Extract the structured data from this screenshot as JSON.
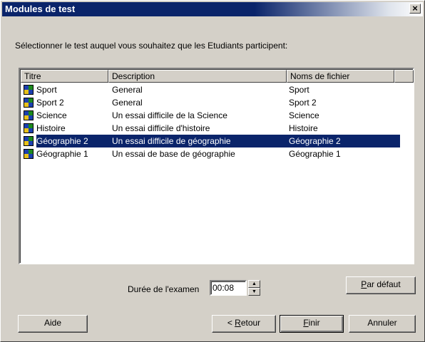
{
  "window": {
    "title": "Modules de test",
    "close_glyph": "×"
  },
  "instruction": "Sélectionner le test auquel vous souhaitez que les Etudiants participent:",
  "list": {
    "columns": [
      "Titre",
      "Description",
      "Noms de fichier"
    ],
    "selected_row_index": 4,
    "rows": [
      {
        "icon": "test-module-icon",
        "title": "Sport",
        "description": "General",
        "filename": "Sport"
      },
      {
        "icon": "test-module-icon",
        "title": "Sport 2",
        "description": "General",
        "filename": "Sport 2"
      },
      {
        "icon": "test-module-icon",
        "title": "Science",
        "description": "Un essai difficile de la Science",
        "filename": "Science"
      },
      {
        "icon": "test-module-icon",
        "title": "Histoire",
        "description": "Un essai difficile d'histoire",
        "filename": "Histoire"
      },
      {
        "icon": "test-module-icon",
        "title": "Géographie 2",
        "description": "Un essai difficile de géographie",
        "filename": "Géographie 2"
      },
      {
        "icon": "test-module-icon",
        "title": "Géographie 1",
        "description": "Un essai de base de géographie",
        "filename": "Géographie 1"
      }
    ]
  },
  "duration": {
    "label": "Durée de l'examen",
    "value": "00:08"
  },
  "buttons": {
    "default_settings": {
      "first": "P",
      "rest": "ar défaut"
    },
    "help": "Aide",
    "back": {
      "prefix": "< ",
      "first": "R",
      "rest": "etour"
    },
    "finish": {
      "first": "F",
      "rest": "inir"
    },
    "cancel": "Annuler"
  },
  "colors": {
    "selection": "#0a246a",
    "titlebar": "#0a246a",
    "face": "#d4d0c8"
  }
}
